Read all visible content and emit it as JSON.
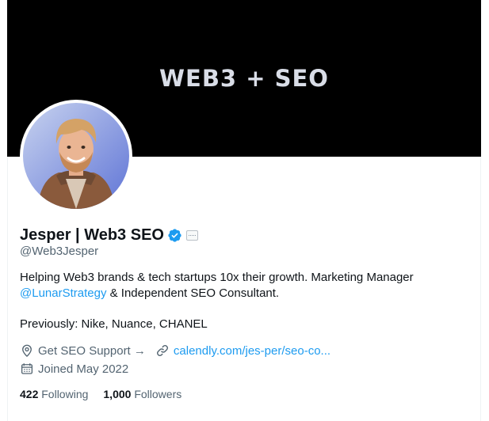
{
  "banner": {
    "text": "WEB3 + SEO"
  },
  "profile": {
    "name": "Jesper | Web3 SEO",
    "handle": "@Web3Jesper",
    "bio_line1": "Helping Web3 brands & tech startups 10x their growth. Marketing Manager",
    "bio_mention": "@LunarStrategy",
    "bio_line2_rest": " & Independent SEO Consultant.",
    "bio_line3": "Previously: Nike, Nuance, CHANEL",
    "location": "Get SEO Support →",
    "website": "calendly.com/jes-per/seo-co...",
    "joined": "Joined May 2022"
  },
  "counts": {
    "following_value": "422",
    "following_label": "Following",
    "followers_value": "1,000",
    "followers_label": "Followers"
  },
  "colors": {
    "accent": "#1d9bf0",
    "banner_bg": "#000000",
    "secondary_text": "#536471"
  },
  "icons": [
    "verified-badge-icon",
    "affiliate-badge-icon",
    "location-pin-icon",
    "link-icon",
    "calendar-icon"
  ]
}
